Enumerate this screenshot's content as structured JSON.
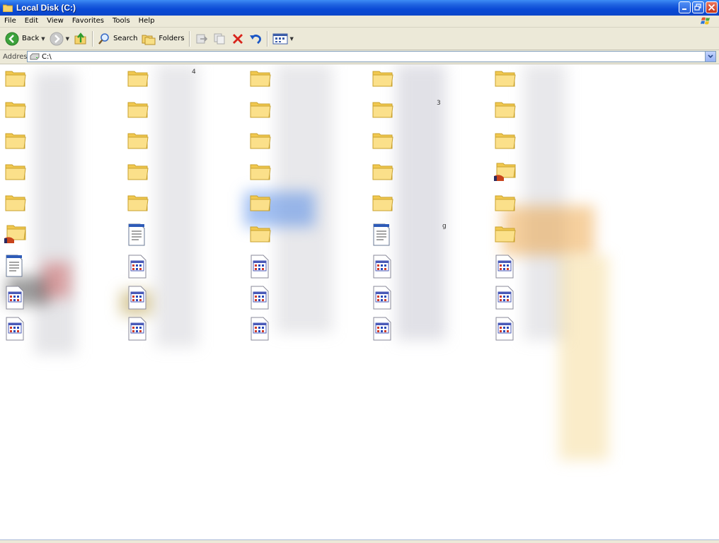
{
  "window": {
    "title": "Local Disk (C:)",
    "accent": "#0a4ad6"
  },
  "menu": [
    "File",
    "Edit",
    "View",
    "Favorites",
    "Tools",
    "Help"
  ],
  "toolbar": {
    "back_label": "Back",
    "search_label": "Search",
    "folders_label": "Folders"
  },
  "address": {
    "label": "Address",
    "value": "C:\\"
  },
  "files": {
    "columns": [
      [
        {
          "type": "folder",
          "name": ""
        },
        {
          "type": "folder",
          "name": ""
        },
        {
          "type": "folder",
          "name": ""
        },
        {
          "type": "folder",
          "name": ""
        },
        {
          "type": "folder",
          "name": ""
        },
        {
          "type": "shared-folder",
          "name": ""
        },
        {
          "type": "text-file",
          "name": ""
        },
        {
          "type": "system-file",
          "name": ""
        },
        {
          "type": "system-file",
          "name": ""
        }
      ],
      [
        {
          "type": "folder",
          "name": "4"
        },
        {
          "type": "folder",
          "name": ""
        },
        {
          "type": "folder",
          "name": ""
        },
        {
          "type": "folder",
          "name": ""
        },
        {
          "type": "folder",
          "name": ""
        },
        {
          "type": "text-file",
          "name": ""
        },
        {
          "type": "system-file",
          "name": ""
        },
        {
          "type": "system-file",
          "name": ""
        },
        {
          "type": "system-file",
          "name": ""
        }
      ],
      [
        {
          "type": "folder",
          "name": ""
        },
        {
          "type": "folder",
          "name": ""
        },
        {
          "type": "folder",
          "name": ""
        },
        {
          "type": "folder",
          "name": ""
        },
        {
          "type": "folder",
          "name": ""
        },
        {
          "type": "folder",
          "name": ""
        },
        {
          "type": "system-file",
          "name": ""
        },
        {
          "type": "system-file",
          "name": ""
        },
        {
          "type": "system-file",
          "name": ""
        }
      ],
      [
        {
          "type": "folder",
          "name": ""
        },
        {
          "type": "folder",
          "name": "3"
        },
        {
          "type": "folder",
          "name": ""
        },
        {
          "type": "folder",
          "name": ""
        },
        {
          "type": "folder",
          "name": ""
        },
        {
          "type": "text-file",
          "name": "g"
        },
        {
          "type": "system-file",
          "name": ""
        },
        {
          "type": "system-file",
          "name": ""
        },
        {
          "type": "system-file",
          "name": ""
        }
      ],
      [
        {
          "type": "folder",
          "name": ""
        },
        {
          "type": "folder",
          "name": ""
        },
        {
          "type": "folder",
          "name": ""
        },
        {
          "type": "shared-folder",
          "name": ""
        },
        {
          "type": "folder",
          "name": ""
        },
        {
          "type": "folder",
          "name": ""
        },
        {
          "type": "system-file",
          "name": ""
        },
        {
          "type": "system-file",
          "name": ""
        },
        {
          "type": "system-file",
          "name": ""
        }
      ]
    ]
  }
}
